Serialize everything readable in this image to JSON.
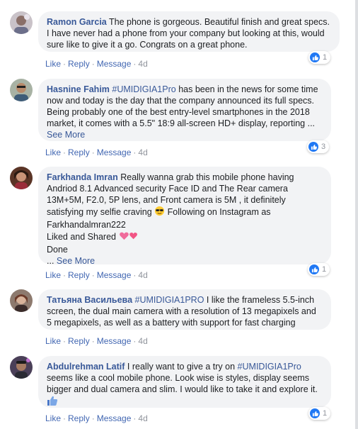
{
  "comments": [
    {
      "author": "Ramon Garcia",
      "text": "The phone is gorgeous. Beautiful finish and great specs. I have never had a phone from your company but looking at this, would sure like to give it a go. Congrats on a great phone.",
      "likes": "1",
      "time": "4d"
    },
    {
      "author": "Hasnine Fahim",
      "hashtag": "#UMIDIGIA1Pro",
      "text": "has been in the news for some time now and today is the day that the company announced its full specs. Being probably one of the best entry-level smartphones in the 2018 market, it comes with a 5.5\" 18:9 all-screen HD+ display, reporting ...",
      "see_more": "See More",
      "likes": "3",
      "time": "4d"
    },
    {
      "author": "Farkhanda Imran",
      "text": "Really wanna grab this mobile phone having Andriod 8.1 Advanced security Face ID and The Rear camera 13M+5M, F2.0, 5P lens, and Front camera is 5M , it definitely satisfying my selfie craving",
      "text2": "Following on Instagram as Farkhandalmran222",
      "text3": "Liked and Shared",
      "text4": "Done",
      "ellipsis": "...",
      "see_more": "See More",
      "likes": "1",
      "time": "4d"
    },
    {
      "author": "Татьяна Васильева",
      "hashtag": "#UMIDIGIA1PRO",
      "text": "I like the frameless 5.5-inch screen, the dual main camera with a resolution of 13 megapixels and 5 megapixels, as well as a battery with support for fast charging",
      "time": "4d"
    },
    {
      "author": "Abdulrehman Latif",
      "text_before": "I really want to give a try on",
      "hashtag": "#UMIDIGIA1Pro",
      "text": "seems like a cool mobile phone. Look wise is styles, display seems bigger and dual camera and slim. I would like to take it and explore it.",
      "likes": "1",
      "time": "4d"
    }
  ],
  "actions": {
    "like": "Like",
    "reply": "Reply",
    "message": "Message",
    "separator": "·"
  },
  "colors": {
    "link": "#385898",
    "action": "#4267b2",
    "bubble": "#f2f3f5",
    "like_badge": "#2078f4"
  },
  "icons": [
    "like-icon",
    "sunglasses-emoji",
    "heart-emoji",
    "thumbs-up-emoji"
  ]
}
